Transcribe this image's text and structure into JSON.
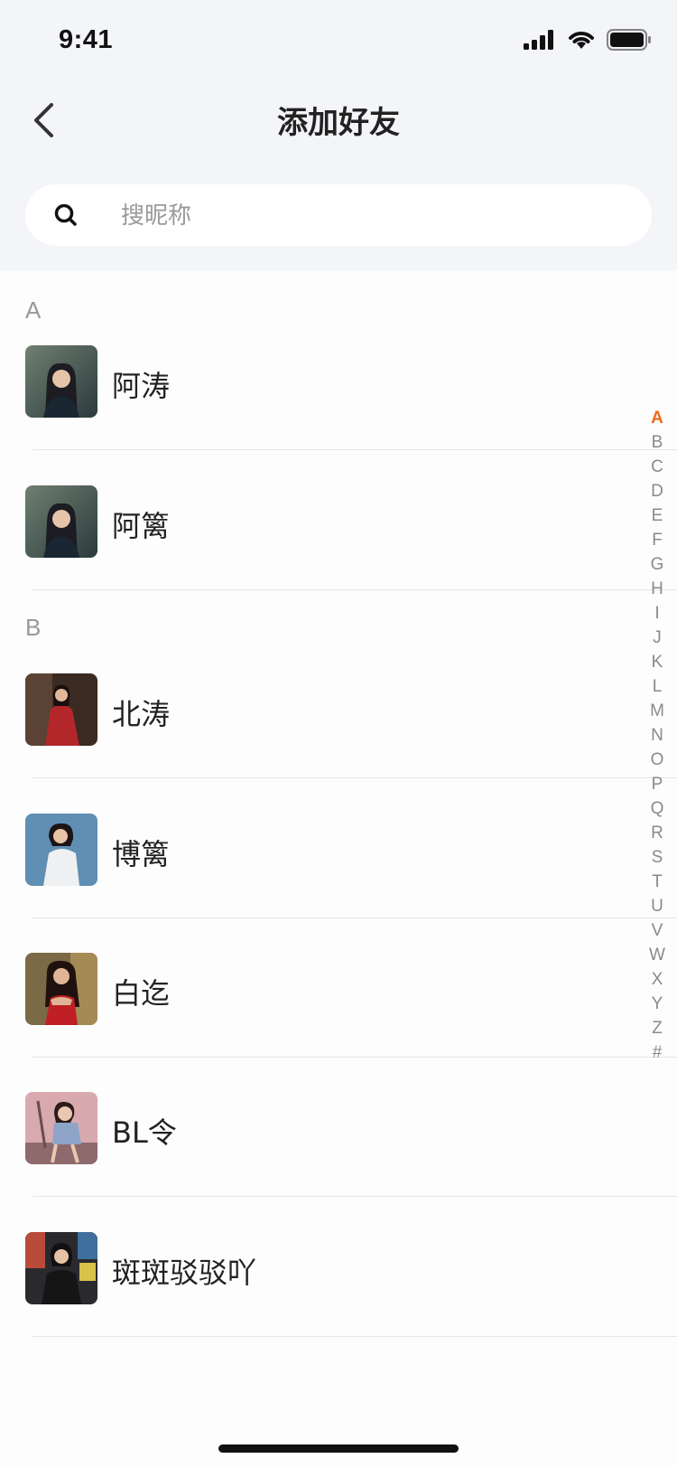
{
  "status": {
    "time": "9:41"
  },
  "header": {
    "title": "添加好友"
  },
  "search": {
    "placeholder": "搜昵称",
    "value": ""
  },
  "sections": [
    {
      "letter": "A",
      "items": [
        {
          "name": "阿涛"
        },
        {
          "name": "阿篱"
        }
      ]
    },
    {
      "letter": "B",
      "items": [
        {
          "name": "北涛"
        },
        {
          "name": "博篱"
        },
        {
          "name": "白迄"
        },
        {
          "name": "BL令"
        },
        {
          "name": "斑斑驳驳吖"
        }
      ]
    }
  ],
  "index": {
    "letters": [
      "A",
      "B",
      "C",
      "D",
      "E",
      "F",
      "G",
      "H",
      "I",
      "J",
      "K",
      "L",
      "M",
      "N",
      "O",
      "P",
      "Q",
      "R",
      "S",
      "T",
      "U",
      "V",
      "W",
      "X",
      "Y",
      "Z",
      "#"
    ],
    "active": "A"
  },
  "colors": {
    "accent": "#f06a1b",
    "header_bg": "#f4f5f9"
  }
}
